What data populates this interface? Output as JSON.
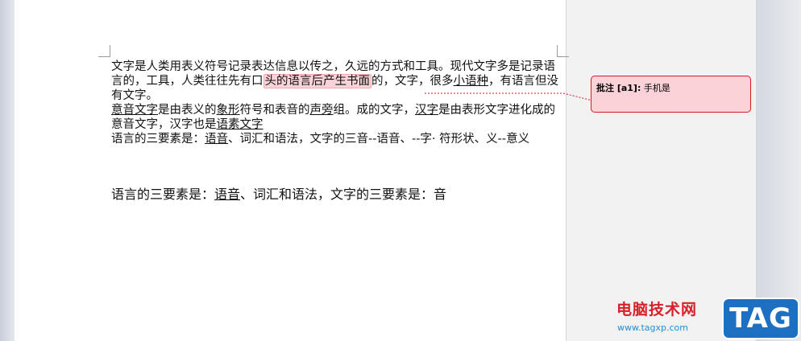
{
  "document": {
    "p1": {
      "a": "文字是人类用表义符号记录表达信息以传之，久远的方式和工具。现代文字多是记录语言的，工具，人类往往先有口",
      "highlight": "头的语言后产生书面",
      "b": "的，文字，很多",
      "u1": "小语种",
      "c": "，有语言但没有文字。"
    },
    "p2": {
      "u1": "意音文字",
      "a": "是由表义的",
      "u2": "象形",
      "b": "符号和表音的",
      "u3": "声旁",
      "c": "组。成的文字，",
      "u4": "汉字",
      "d": "是由表形文字进化成的意音文字，汉字也是",
      "u5": "语素文字"
    },
    "p3": {
      "a": "语言的三要素是：",
      "u1": "语音",
      "b": "、词汇和语法，文字的三音--语音、--字· 符形状、义--意义"
    },
    "p4": {
      "a": "语言的三要素是：",
      "u1": "语音",
      "b": "、词汇和语法，文字的三要素是：音"
    }
  },
  "comment": {
    "label": "批注 [a1]:",
    "text": " 手机是",
    "color": "#d9182a",
    "fill": "#fbd2d8"
  },
  "watermark": {
    "title": "电脑技术网",
    "url": "www.tagxp.com",
    "badge": "TAG"
  }
}
